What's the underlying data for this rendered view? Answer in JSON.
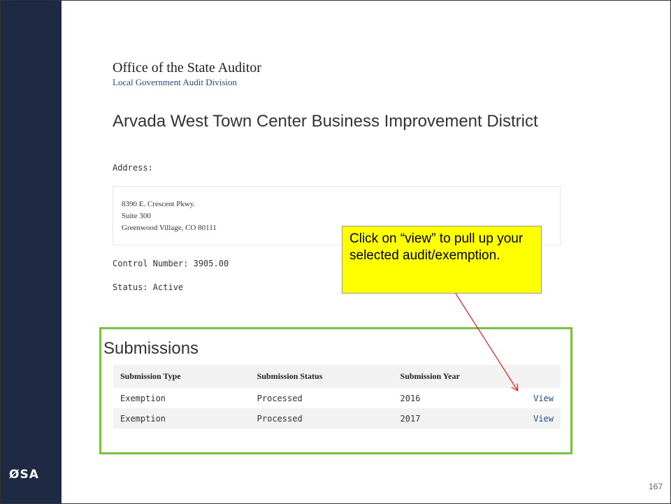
{
  "header": {
    "office": "Office of the State Auditor",
    "division": "Local Government Audit Division"
  },
  "entity": {
    "name": "Arvada West Town Center Business Improvement District",
    "address_label": "Address:",
    "address_lines": [
      "8390 E. Crescent Pkwy.",
      "Suite 300",
      "Greenwood Village, CO 80111"
    ],
    "control_number": "Control Number: 3905.00",
    "status": "Status: Active"
  },
  "callout": {
    "text": "Click on “view” to pull up your selected audit/exemption."
  },
  "submissions": {
    "title": "Submissions",
    "columns": [
      "Submission Type",
      "Submission Status",
      "Submission Year",
      ""
    ],
    "rows": [
      {
        "type": "Exemption",
        "status": "Processed",
        "year": "2016",
        "action": "View"
      },
      {
        "type": "Exemption",
        "status": "Processed",
        "year": "2017",
        "action": "View"
      }
    ]
  },
  "slide": {
    "logo": "ØSA",
    "page_number": "167"
  },
  "colors": {
    "sidebar": "#1e2a44",
    "callout": "#ffff00",
    "panel_border": "#7ac143",
    "arrow": "#e31b23",
    "link": "#1f4e8c"
  }
}
